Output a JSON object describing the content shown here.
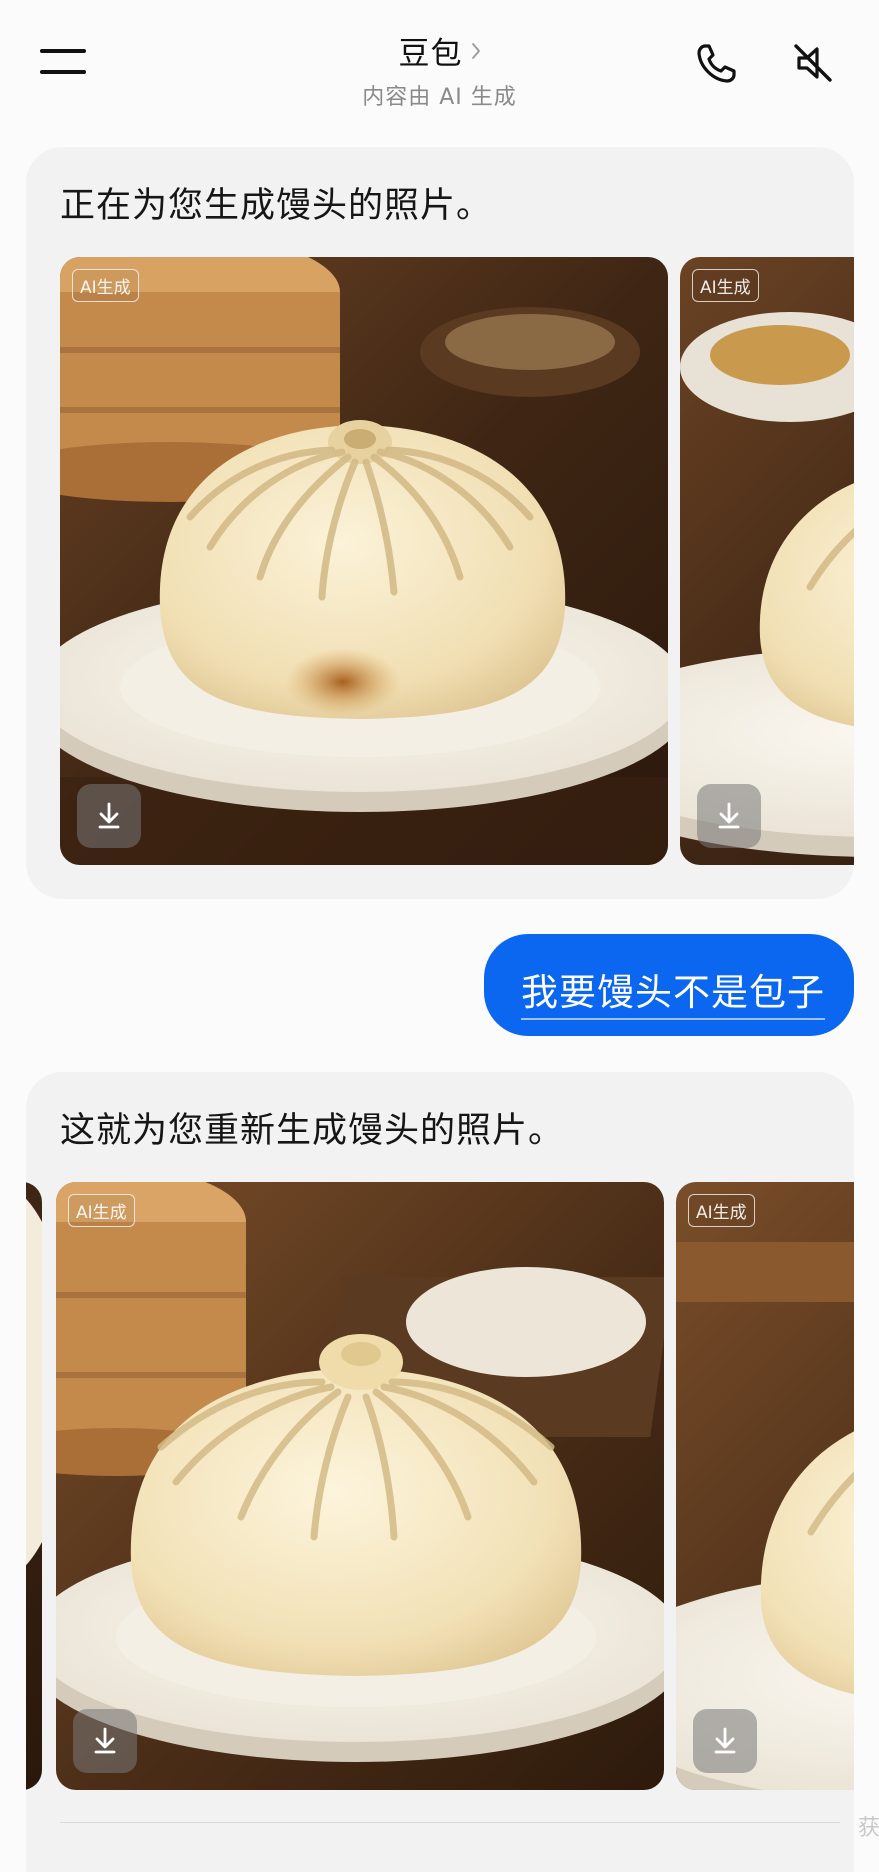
{
  "header": {
    "title": "豆包",
    "subtitle": "内容由 AI 生成",
    "menu_icon": "menu-icon",
    "phone_icon": "phone-icon",
    "mute_icon": "mute-icon"
  },
  "messages": [
    {
      "role": "assistant",
      "text": "正在为您生成馒头的照片。",
      "images": [
        {
          "badge": "AI生成"
        },
        {
          "badge": "AI生成"
        }
      ]
    },
    {
      "role": "user",
      "text": "我要馒头不是包子"
    },
    {
      "role": "assistant",
      "text": "这就为您重新生成馒头的照片。",
      "images": [
        {
          "badge": "AI生成"
        },
        {
          "badge": "AI生成"
        }
      ]
    }
  ],
  "colors": {
    "accent": "#0b66f0",
    "card_bg": "#f2f2f2",
    "page_bg": "#fbfbfb"
  },
  "edge_char": "获"
}
